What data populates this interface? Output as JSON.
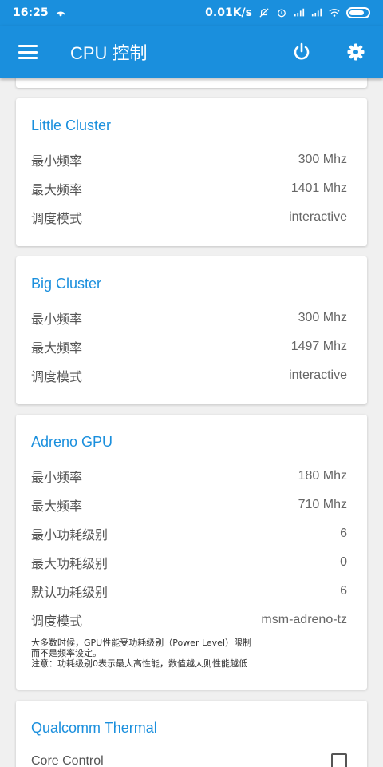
{
  "status_bar": {
    "time": "16:25",
    "net_speed": "0.01K/s",
    "icons": [
      "hotspot-icon",
      "silent-icon",
      "alarm-icon",
      "signal-icon",
      "signal-icon",
      "wifi-icon",
      "battery-icon"
    ]
  },
  "toolbar": {
    "title": "CPU 控制",
    "icons": [
      "menu-icon",
      "power-icon",
      "gear-icon"
    ],
    "color": "#1a8fdd"
  },
  "little_cluster": {
    "title": "Little Cluster",
    "rows": [
      {
        "label": "最小频率",
        "value": "300 Mhz"
      },
      {
        "label": "最大频率",
        "value": "1401 Mhz"
      },
      {
        "label": "调度模式",
        "value": "interactive"
      }
    ]
  },
  "big_cluster": {
    "title": "Big Cluster",
    "rows": [
      {
        "label": "最小频率",
        "value": "300 Mhz"
      },
      {
        "label": "最大频率",
        "value": "1497 Mhz"
      },
      {
        "label": "调度模式",
        "value": "interactive"
      }
    ]
  },
  "adreno_gpu": {
    "title": "Adreno GPU",
    "rows": [
      {
        "label": "最小频率",
        "value": "180 Mhz"
      },
      {
        "label": "最大频率",
        "value": "710 Mhz"
      },
      {
        "label": "最小功耗级别",
        "value": "6"
      },
      {
        "label": "最大功耗级别",
        "value": "0"
      },
      {
        "label": "默认功耗级别",
        "value": "6"
      },
      {
        "label": "调度模式",
        "value": "msm-adreno-tz"
      }
    ],
    "note_lines": [
      "大多数时候，GPU性能受功耗级别（Power Level）限制",
      "而不是频率设定。",
      "注意：功耗级别0表示最大高性能，数值越大则性能越低"
    ]
  },
  "qualcomm_thermal": {
    "title": "Qualcomm Thermal",
    "rows": [
      {
        "label": "Core Control",
        "checked": false
      }
    ]
  }
}
